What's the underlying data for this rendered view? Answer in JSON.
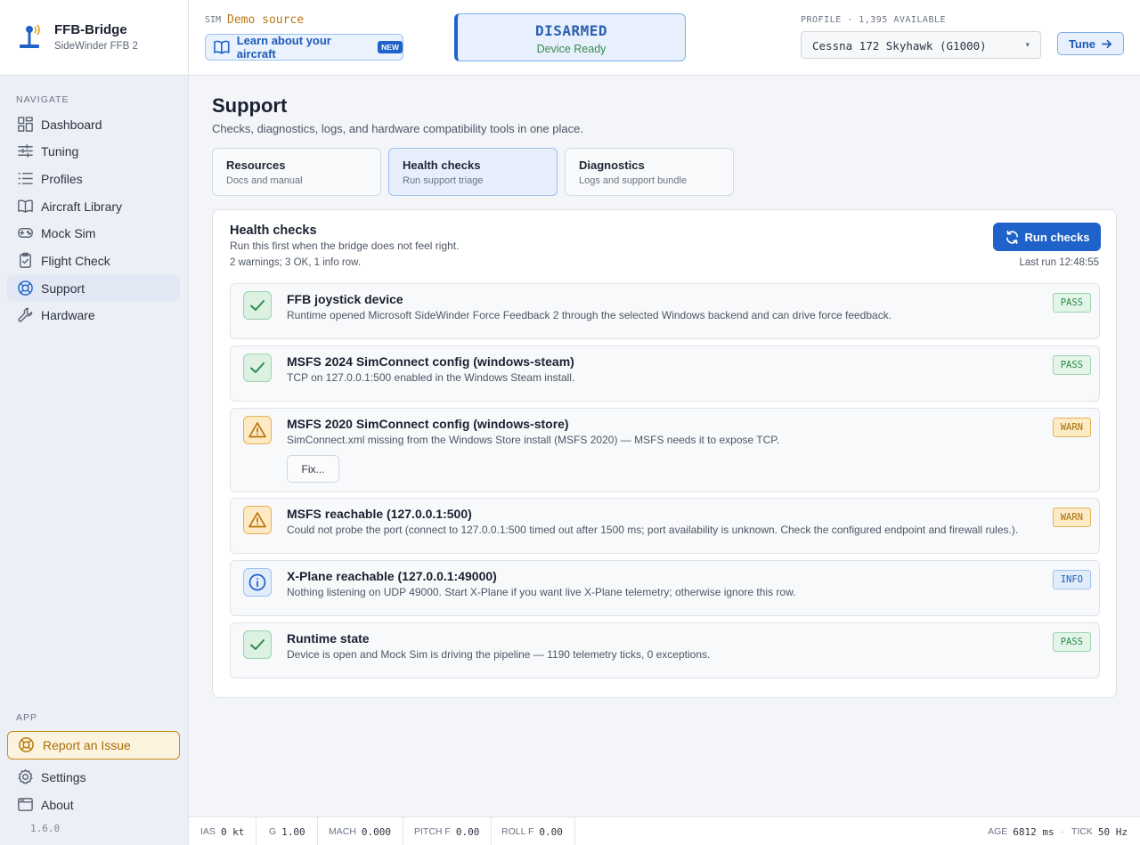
{
  "brand": {
    "name": "FFB-Bridge",
    "subtitle": "SideWinder FFB 2"
  },
  "sidebar": {
    "navigate_label": "NAVIGATE",
    "items": [
      {
        "label": "Dashboard",
        "icon": "dashboard-icon"
      },
      {
        "label": "Tuning",
        "icon": "sliders-icon"
      },
      {
        "label": "Profiles",
        "icon": "list-icon"
      },
      {
        "label": "Aircraft Library",
        "icon": "book-icon"
      },
      {
        "label": "Mock Sim",
        "icon": "gamepad-icon"
      },
      {
        "label": "Flight Check",
        "icon": "clipboard-check-icon"
      },
      {
        "label": "Support",
        "icon": "lifebuoy-icon",
        "active": true
      },
      {
        "label": "Hardware",
        "icon": "wrench-icon"
      }
    ],
    "app_label": "APP",
    "report_issue": "Report an Issue",
    "settings": "Settings",
    "about": "About",
    "version": "1.6.0"
  },
  "header": {
    "sim_label": "SIM",
    "sim_source": "Demo source",
    "learn_label": "Learn about your aircraft",
    "learn_badge": "NEW",
    "arm_status": "DISARMED",
    "arm_sub": "Device Ready",
    "profile_label": "PROFILE · 1,395 AVAILABLE",
    "profile_value": "Cessna 172 Skyhawk (G1000)",
    "tune_label": "Tune"
  },
  "page": {
    "title": "Support",
    "subtitle": "Checks, diagnostics, logs, and hardware compatibility tools in one place.",
    "tabs": [
      {
        "title": "Resources",
        "sub": "Docs and manual"
      },
      {
        "title": "Health checks",
        "sub": "Run support triage",
        "active": true
      },
      {
        "title": "Diagnostics",
        "sub": "Logs and support bundle"
      }
    ]
  },
  "health": {
    "title": "Health checks",
    "subtitle": "Run this first when the bridge does not feel right.",
    "summary": "2 warnings; 3 OK, 1 info row.",
    "run_label": "Run checks",
    "last_run": "Last run 12:48:55",
    "checks": [
      {
        "title": "FFB joystick device",
        "desc": "Runtime opened Microsoft SideWinder Force Feedback 2 through the selected Windows backend and can drive force feedback.",
        "status": "PASS"
      },
      {
        "title": "MSFS 2024 SimConnect config (windows-steam)",
        "desc": "TCP on 127.0.0.1:500 enabled in the Windows Steam install.",
        "status": "PASS"
      },
      {
        "title": "MSFS 2020 SimConnect config (windows-store)",
        "desc": "SimConnect.xml missing from the Windows Store install (MSFS 2020) — MSFS needs it to expose TCP.",
        "status": "WARN",
        "action": "Fix..."
      },
      {
        "title": "MSFS reachable (127.0.0.1:500)",
        "desc": "Could not probe the port (connect to 127.0.0.1:500 timed out after 1500 ms; port availability is unknown. Check the configured endpoint and firewall rules.).",
        "status": "WARN"
      },
      {
        "title": "X-Plane reachable (127.0.0.1:49000)",
        "desc": "Nothing listening on UDP 49000. Start X-Plane if you want live X-Plane telemetry; otherwise ignore this row.",
        "status": "INFO"
      },
      {
        "title": "Runtime state",
        "desc": "Device is open and Mock Sim is driving the pipeline — 1190 telemetry ticks, 0 exceptions.",
        "status": "PASS"
      }
    ]
  },
  "statusbar": {
    "ias_label": "IAS",
    "ias_value": "0 kt",
    "g_label": "G",
    "g_value": "1.00",
    "mach_label": "MACH",
    "mach_value": "0.000",
    "pitch_label": "PITCH F",
    "pitch_value": "0.00",
    "roll_label": "ROLL F",
    "roll_value": "0.00",
    "age_label": "AGE",
    "age_value": "6812 ms",
    "tick_label": "TICK",
    "tick_value": "50 Hz"
  },
  "colors": {
    "accent": "#1f62c9",
    "pass": "#2e8a4a",
    "warn": "#b7750b",
    "report": "#c98b16"
  }
}
